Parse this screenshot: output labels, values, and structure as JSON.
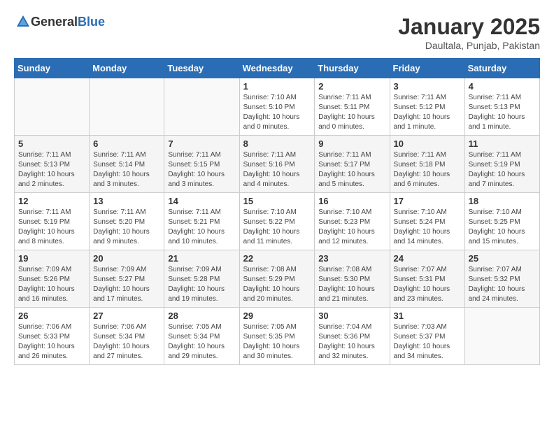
{
  "header": {
    "logo_general": "General",
    "logo_blue": "Blue",
    "title": "January 2025",
    "subtitle": "Daultala, Punjab, Pakistan"
  },
  "weekdays": [
    "Sunday",
    "Monday",
    "Tuesday",
    "Wednesday",
    "Thursday",
    "Friday",
    "Saturday"
  ],
  "weeks": [
    [
      {
        "day": "",
        "info": ""
      },
      {
        "day": "",
        "info": ""
      },
      {
        "day": "",
        "info": ""
      },
      {
        "day": "1",
        "info": "Sunrise: 7:10 AM\nSunset: 5:10 PM\nDaylight: 10 hours\nand 0 minutes."
      },
      {
        "day": "2",
        "info": "Sunrise: 7:11 AM\nSunset: 5:11 PM\nDaylight: 10 hours\nand 0 minutes."
      },
      {
        "day": "3",
        "info": "Sunrise: 7:11 AM\nSunset: 5:12 PM\nDaylight: 10 hours\nand 1 minute."
      },
      {
        "day": "4",
        "info": "Sunrise: 7:11 AM\nSunset: 5:13 PM\nDaylight: 10 hours\nand 1 minute."
      }
    ],
    [
      {
        "day": "5",
        "info": "Sunrise: 7:11 AM\nSunset: 5:13 PM\nDaylight: 10 hours\nand 2 minutes."
      },
      {
        "day": "6",
        "info": "Sunrise: 7:11 AM\nSunset: 5:14 PM\nDaylight: 10 hours\nand 3 minutes."
      },
      {
        "day": "7",
        "info": "Sunrise: 7:11 AM\nSunset: 5:15 PM\nDaylight: 10 hours\nand 3 minutes."
      },
      {
        "day": "8",
        "info": "Sunrise: 7:11 AM\nSunset: 5:16 PM\nDaylight: 10 hours\nand 4 minutes."
      },
      {
        "day": "9",
        "info": "Sunrise: 7:11 AM\nSunset: 5:17 PM\nDaylight: 10 hours\nand 5 minutes."
      },
      {
        "day": "10",
        "info": "Sunrise: 7:11 AM\nSunset: 5:18 PM\nDaylight: 10 hours\nand 6 minutes."
      },
      {
        "day": "11",
        "info": "Sunrise: 7:11 AM\nSunset: 5:19 PM\nDaylight: 10 hours\nand 7 minutes."
      }
    ],
    [
      {
        "day": "12",
        "info": "Sunrise: 7:11 AM\nSunset: 5:19 PM\nDaylight: 10 hours\nand 8 minutes."
      },
      {
        "day": "13",
        "info": "Sunrise: 7:11 AM\nSunset: 5:20 PM\nDaylight: 10 hours\nand 9 minutes."
      },
      {
        "day": "14",
        "info": "Sunrise: 7:11 AM\nSunset: 5:21 PM\nDaylight: 10 hours\nand 10 minutes."
      },
      {
        "day": "15",
        "info": "Sunrise: 7:10 AM\nSunset: 5:22 PM\nDaylight: 10 hours\nand 11 minutes."
      },
      {
        "day": "16",
        "info": "Sunrise: 7:10 AM\nSunset: 5:23 PM\nDaylight: 10 hours\nand 12 minutes."
      },
      {
        "day": "17",
        "info": "Sunrise: 7:10 AM\nSunset: 5:24 PM\nDaylight: 10 hours\nand 14 minutes."
      },
      {
        "day": "18",
        "info": "Sunrise: 7:10 AM\nSunset: 5:25 PM\nDaylight: 10 hours\nand 15 minutes."
      }
    ],
    [
      {
        "day": "19",
        "info": "Sunrise: 7:09 AM\nSunset: 5:26 PM\nDaylight: 10 hours\nand 16 minutes."
      },
      {
        "day": "20",
        "info": "Sunrise: 7:09 AM\nSunset: 5:27 PM\nDaylight: 10 hours\nand 17 minutes."
      },
      {
        "day": "21",
        "info": "Sunrise: 7:09 AM\nSunset: 5:28 PM\nDaylight: 10 hours\nand 19 minutes."
      },
      {
        "day": "22",
        "info": "Sunrise: 7:08 AM\nSunset: 5:29 PM\nDaylight: 10 hours\nand 20 minutes."
      },
      {
        "day": "23",
        "info": "Sunrise: 7:08 AM\nSunset: 5:30 PM\nDaylight: 10 hours\nand 21 minutes."
      },
      {
        "day": "24",
        "info": "Sunrise: 7:07 AM\nSunset: 5:31 PM\nDaylight: 10 hours\nand 23 minutes."
      },
      {
        "day": "25",
        "info": "Sunrise: 7:07 AM\nSunset: 5:32 PM\nDaylight: 10 hours\nand 24 minutes."
      }
    ],
    [
      {
        "day": "26",
        "info": "Sunrise: 7:06 AM\nSunset: 5:33 PM\nDaylight: 10 hours\nand 26 minutes."
      },
      {
        "day": "27",
        "info": "Sunrise: 7:06 AM\nSunset: 5:34 PM\nDaylight: 10 hours\nand 27 minutes."
      },
      {
        "day": "28",
        "info": "Sunrise: 7:05 AM\nSunset: 5:34 PM\nDaylight: 10 hours\nand 29 minutes."
      },
      {
        "day": "29",
        "info": "Sunrise: 7:05 AM\nSunset: 5:35 PM\nDaylight: 10 hours\nand 30 minutes."
      },
      {
        "day": "30",
        "info": "Sunrise: 7:04 AM\nSunset: 5:36 PM\nDaylight: 10 hours\nand 32 minutes."
      },
      {
        "day": "31",
        "info": "Sunrise: 7:03 AM\nSunset: 5:37 PM\nDaylight: 10 hours\nand 34 minutes."
      },
      {
        "day": "",
        "info": ""
      }
    ]
  ]
}
